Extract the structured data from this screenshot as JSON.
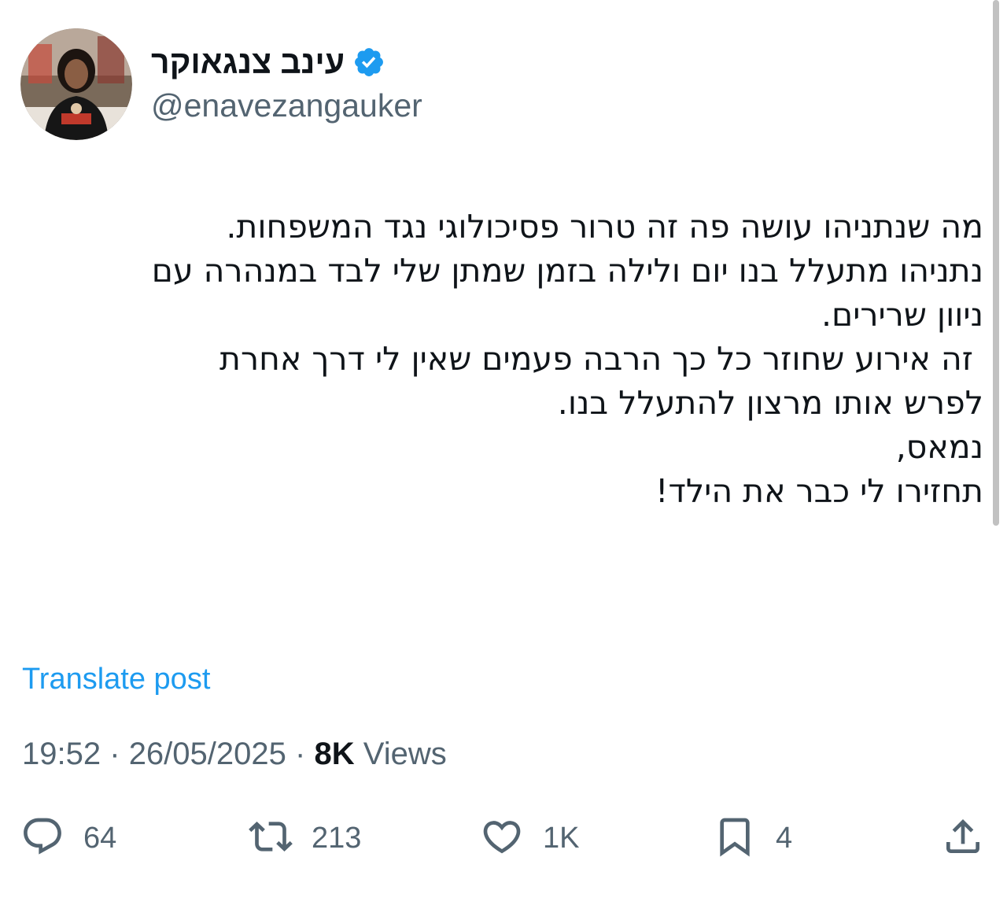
{
  "author": {
    "display_name": "עינב צנגאוקר",
    "handle": "@enavezangauker",
    "verified_icon": "verified-badge-icon",
    "verified_color": "#1d9bf0"
  },
  "tweet": {
    "lines": [
      "מה שנתניהו עושה פה זה טרור פסיכולוגי נגד המשפחות.",
      "נתניהו מתעלל בנו יום ולילה בזמן שמתן שלי לבד במנהרה עם",
      "ניוון שרירים.",
      " זה אירוע שחוזר כל כך הרבה פעמים שאין לי דרך אחרת",
      "לפרש אותו מרצון להתעלל בנו.",
      "נמאס,",
      "תחזירו לי כבר את הילד!"
    ]
  },
  "translate_label": "Translate post",
  "meta": {
    "time": "19:52",
    "separator": "·",
    "date": "26/05/2025",
    "views_count": "8K",
    "views_label": "Views"
  },
  "actions": {
    "replies": "64",
    "reposts": "213",
    "likes": "1K",
    "bookmarks": "4"
  },
  "colors": {
    "text": "#0f1419",
    "secondary": "#536471",
    "link": "#1d9bf0"
  }
}
